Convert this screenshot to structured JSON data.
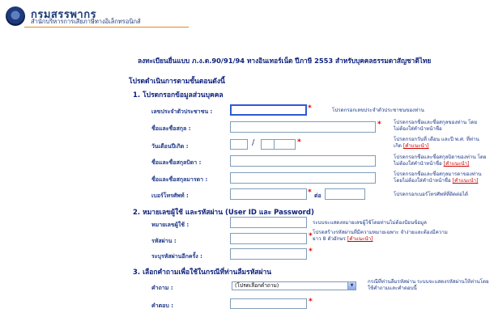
{
  "header": {
    "brand": "กรมสรรพากร",
    "subtitle": "สำนักบริหารการเสียภาษีทางอิเล็กทรอนิกส์"
  },
  "page": {
    "title": "ลงทะเบียนยื่นแบบ ภ.ง.ด.90/91/94 ทางอินเทอร์เน็ต ปีภาษี 2553 สำหรับบุคคลธรรมดาสัญชาติไทย",
    "instruction": "โปรดดำเนินการตามขั้นตอนดังนี้"
  },
  "section1": {
    "heading": "1. โปรดกรอกข้อมูลส่วนบุคคล",
    "id_label": "เลขประจำตัวประชาชน :",
    "id_hint": "โปรดกรอกเลขประจำตัวประชาชนของท่าน",
    "name_label": "ชื่อและชื่อสกุล :",
    "name_hint": "โปรดกรอกชื่อและชื่อสกุลของท่าน โดยไม่ต้องใส่คำนำหน้าชื่อ",
    "dob_label": "วันเดือนปีเกิด :",
    "dob_sep": "/",
    "dob_hint": "โปรดกรอกวันที่ เดือน และปี พ.ศ. ที่ท่านเกิด",
    "dob_link": "[คำแนะนำ]",
    "father_label": "ชื่อและชื่อสกุลบิดา :",
    "father_hint": "โปรดกรอกชื่อและชื่อสกุลบิดาของท่าน โดยไม่ต้องใส่คำนำหน้าชื่อ",
    "father_link": "[คำแนะนำ]",
    "mother_label": "ชื่อและชื่อสกุลมารดา :",
    "mother_hint": "โปรดกรอกชื่อและชื่อสกุลมารดาของท่าน โดยไม่ต้องใส่คำนำหน้าชื่อ",
    "mother_link": "[คำแนะนำ]",
    "phone_label": "เบอร์โทรศัพท์ :",
    "ext_label": "ต่อ",
    "phone_hint": "โปรดกรอกเบอร์โทรศัพท์ที่ติดต่อได้"
  },
  "section2": {
    "heading": "2. หมายเลขผู้ใช้ และรหัสผ่าน (User ID และ Password)",
    "userid_label": "หมายเลขผู้ใช้ :",
    "userid_hint": "ระบบจะแสดงหมายเลขผู้ใช้โดยท่านไม่ต้องป้อนข้อมูล",
    "password_label": "รหัสผ่าน :",
    "password_hint": "โปรดสร้างรหัสผ่านที่มีความหมายเฉพาะ จำง่ายและต้องมีความยาว 8 ตัวอักษร",
    "password_link": "[คำแนะนำ]",
    "confirm_label": "ระบุรหัสผ่านอีกครั้ง :"
  },
  "section3": {
    "heading": "3. เลือกคำถามเพื่อใช้ในกรณีที่ท่านลืมรหัสผ่าน",
    "question_label": "คำถาม :",
    "question_selected": "(โปรดเลือกคำถาม)",
    "question_hint": "กรณีที่ท่านลืมรหัสผ่าน ระบบจะแสดงรหัสผ่านให้ท่านโดยใช้คำถามและคำตอบนี้",
    "answer_label": "คำตอบ :"
  },
  "required_mark": "*",
  "colors": {
    "brand": "#1e3c7b",
    "heading": "#0b1e7a",
    "required": "#e00000",
    "rule": "#e08a1e"
  }
}
